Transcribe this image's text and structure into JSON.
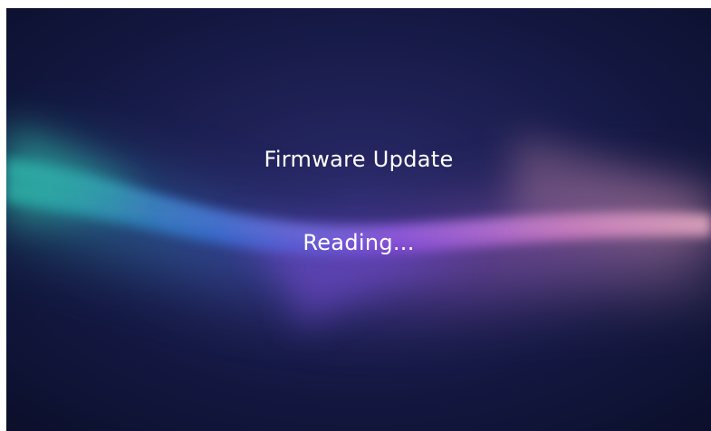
{
  "screen": {
    "title": "Firmware Update",
    "status": "Reading..."
  },
  "colors": {
    "background": "#0f1433",
    "wave_teal": "#2fb3a5",
    "wave_blue": "#4b6be0",
    "wave_purple": "#9b55e0",
    "wave_pink": "#e59ac0",
    "text": "#ffffff"
  }
}
